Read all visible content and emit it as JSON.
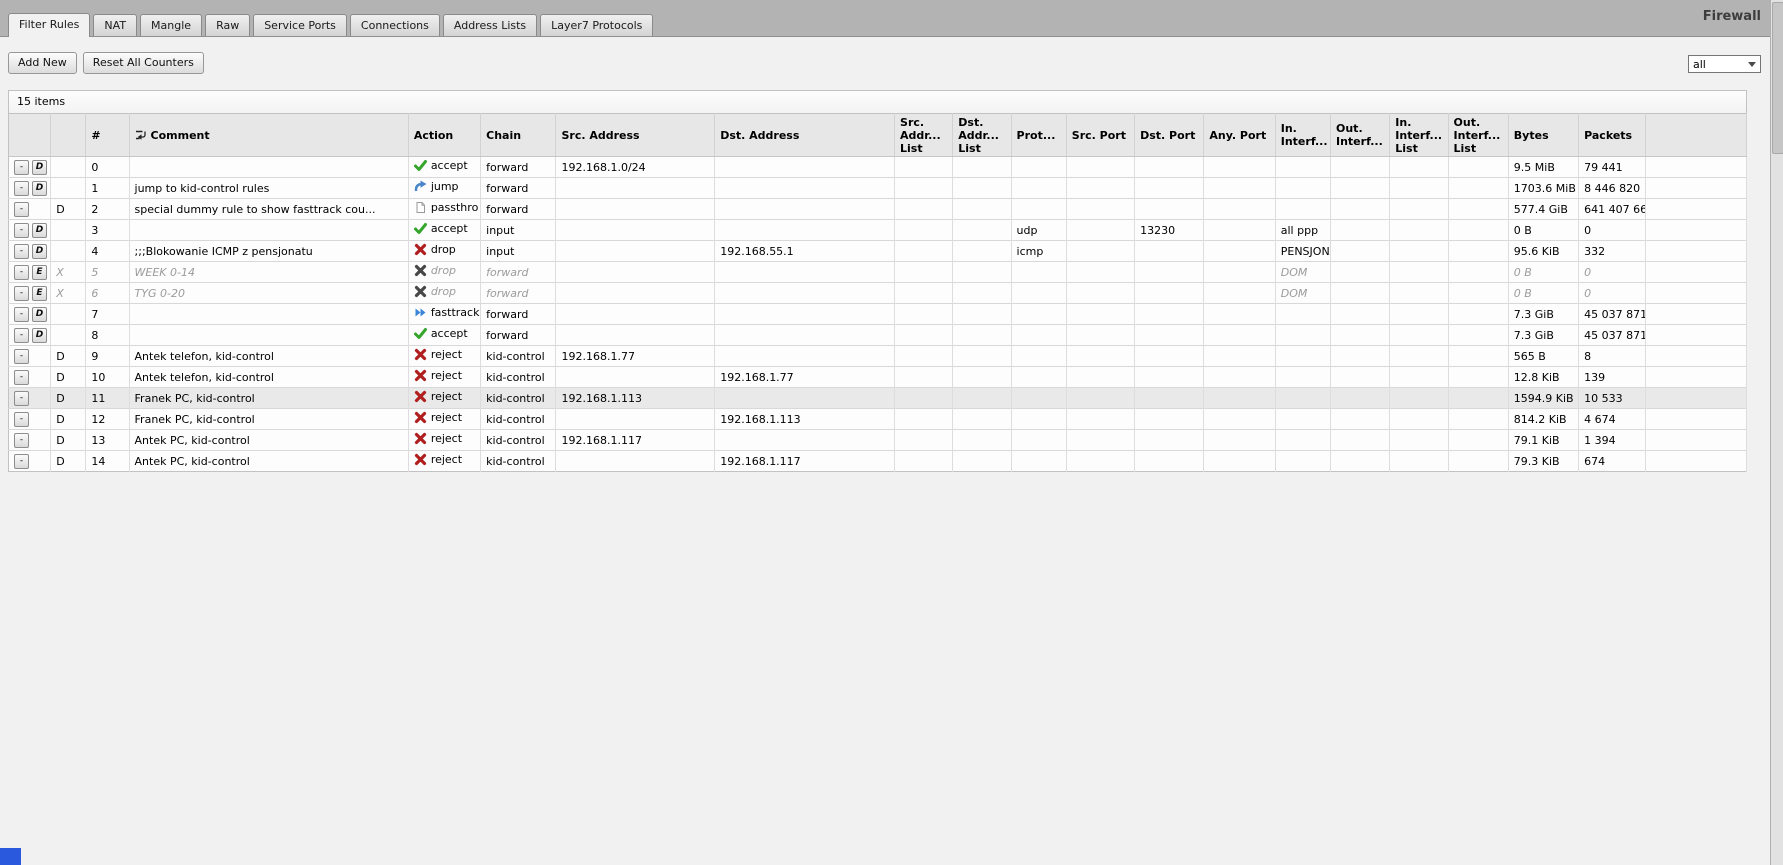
{
  "window": {
    "title": "Firewall"
  },
  "tabs": [
    {
      "label": "Filter Rules",
      "active": true
    },
    {
      "label": "NAT",
      "active": false
    },
    {
      "label": "Mangle",
      "active": false
    },
    {
      "label": "Raw",
      "active": false
    },
    {
      "label": "Service Ports",
      "active": false
    },
    {
      "label": "Connections",
      "active": false
    },
    {
      "label": "Address Lists",
      "active": false
    },
    {
      "label": "Layer7 Protocols",
      "active": false
    }
  ],
  "toolbar": {
    "add_new_label": "Add New",
    "reset_all_label": "Reset All Counters",
    "filter_dropdown_value": "all"
  },
  "table": {
    "items_label": "15 items",
    "columns": [
      {
        "key": "buttons",
        "label": ""
      },
      {
        "key": "flag",
        "label": ""
      },
      {
        "key": "num",
        "label": "#"
      },
      {
        "key": "comment",
        "label": "Comment",
        "icon": "comment-toggle-icon"
      },
      {
        "key": "action",
        "label": "Action"
      },
      {
        "key": "chain",
        "label": "Chain"
      },
      {
        "key": "src_address",
        "label": "Src. Address"
      },
      {
        "key": "dst_address",
        "label": "Dst. Address"
      },
      {
        "key": "src_addr_list",
        "label": "Src. Addr... List"
      },
      {
        "key": "dst_addr_list",
        "label": "Dst. Addr... List"
      },
      {
        "key": "protocol",
        "label": "Prot..."
      },
      {
        "key": "src_port",
        "label": "Src. Port"
      },
      {
        "key": "dst_port",
        "label": "Dst. Port"
      },
      {
        "key": "any_port",
        "label": "Any. Port"
      },
      {
        "key": "in_interface",
        "label": "In. Interf..."
      },
      {
        "key": "out_interface",
        "label": "Out. Interf..."
      },
      {
        "key": "in_interface_list",
        "label": "In. Interf... List"
      },
      {
        "key": "out_interface_list",
        "label": "Out. Interf... List"
      },
      {
        "key": "bytes",
        "label": "Bytes"
      },
      {
        "key": "packets",
        "label": "Packets"
      },
      {
        "key": "spacer",
        "label": ""
      }
    ],
    "actions": {
      "accept": {
        "label": "accept",
        "icon": "check",
        "color": "#35a52d"
      },
      "jump": {
        "label": "jump",
        "icon": "jump",
        "color": "#4a86c8"
      },
      "passthrough": {
        "label": "passthro",
        "icon": "page",
        "color": "#9a9a9a"
      },
      "drop": {
        "label": "drop",
        "icon": "cross",
        "color": "#b01f1f"
      },
      "fasttrack": {
        "label": "fasttrack",
        "icon": "fastforward",
        "color": "#3a85d8"
      },
      "reject": {
        "label": "reject",
        "icon": "cross",
        "color": "#b01f1f"
      }
    },
    "disabled_icon_color": "#474747",
    "rows": [
      {
        "buttons": [
          "-",
          "D"
        ],
        "flag": "",
        "num": "0",
        "comment": "",
        "action": "accept",
        "chain": "forward",
        "src_address": "192.168.1.0/24",
        "dst_address": "",
        "protocol": "",
        "dst_port": "",
        "in_interface": "",
        "bytes": "9.5 MiB",
        "packets": "79 441",
        "disabled": false,
        "highlight": false
      },
      {
        "buttons": [
          "-",
          "D"
        ],
        "flag": "",
        "num": "1",
        "comment": "jump to kid-control rules",
        "action": "jump",
        "chain": "forward",
        "src_address": "",
        "dst_address": "",
        "protocol": "",
        "dst_port": "",
        "in_interface": "",
        "bytes": "1703.6 MiB",
        "packets": "8 446 820",
        "disabled": false,
        "highlight": false
      },
      {
        "buttons": [
          "-"
        ],
        "flag": "D",
        "num": "2",
        "comment": "special dummy rule to show fasttrack cou...",
        "action": "passthrough",
        "chain": "forward",
        "src_address": "",
        "dst_address": "",
        "protocol": "",
        "dst_port": "",
        "in_interface": "",
        "bytes": "577.4 GiB",
        "packets": "641 407 66",
        "disabled": false,
        "highlight": false
      },
      {
        "buttons": [
          "-",
          "D"
        ],
        "flag": "",
        "num": "3",
        "comment": "",
        "action": "accept",
        "chain": "input",
        "src_address": "",
        "dst_address": "",
        "protocol": "udp",
        "dst_port": "13230",
        "in_interface": "all ppp",
        "bytes": "0 B",
        "packets": "0",
        "disabled": false,
        "highlight": false
      },
      {
        "buttons": [
          "-",
          "D"
        ],
        "flag": "",
        "num": "4",
        "comment": ";;;Blokowanie ICMP z pensjonatu",
        "action": "drop",
        "chain": "input",
        "src_address": "",
        "dst_address": "192.168.55.1",
        "protocol": "icmp",
        "dst_port": "",
        "in_interface": "PENSJONAT",
        "bytes": "95.6 KiB",
        "packets": "332",
        "disabled": false,
        "highlight": false
      },
      {
        "buttons": [
          "-",
          "E"
        ],
        "flag": "X",
        "num": "5",
        "comment": "WEEK 0-14",
        "action": "drop",
        "chain": "forward",
        "src_address": "",
        "dst_address": "",
        "protocol": "",
        "dst_port": "",
        "in_interface": "DOM",
        "bytes": "0 B",
        "packets": "0",
        "disabled": true,
        "highlight": false
      },
      {
        "buttons": [
          "-",
          "E"
        ],
        "flag": "X",
        "num": "6",
        "comment": "TYG 0-20",
        "action": "drop",
        "chain": "forward",
        "src_address": "",
        "dst_address": "",
        "protocol": "",
        "dst_port": "",
        "in_interface": "DOM",
        "bytes": "0 B",
        "packets": "0",
        "disabled": true,
        "highlight": false
      },
      {
        "buttons": [
          "-",
          "D"
        ],
        "flag": "",
        "num": "7",
        "comment": "",
        "action": "fasttrack",
        "chain": "forward",
        "src_address": "",
        "dst_address": "",
        "protocol": "",
        "dst_port": "",
        "in_interface": "",
        "bytes": "7.3 GiB",
        "packets": "45 037 871",
        "disabled": false,
        "highlight": false
      },
      {
        "buttons": [
          "-",
          "D"
        ],
        "flag": "",
        "num": "8",
        "comment": "",
        "action": "accept",
        "chain": "forward",
        "src_address": "",
        "dst_address": "",
        "protocol": "",
        "dst_port": "",
        "in_interface": "",
        "bytes": "7.3 GiB",
        "packets": "45 037 871",
        "disabled": false,
        "highlight": false
      },
      {
        "buttons": [
          "-"
        ],
        "flag": "D",
        "num": "9",
        "comment": "Antek telefon, kid-control",
        "action": "reject",
        "chain": "kid-control",
        "src_address": "192.168.1.77",
        "dst_address": "",
        "protocol": "",
        "dst_port": "",
        "in_interface": "",
        "bytes": "565 B",
        "packets": "8",
        "disabled": false,
        "highlight": false
      },
      {
        "buttons": [
          "-"
        ],
        "flag": "D",
        "num": "10",
        "comment": "Antek telefon, kid-control",
        "action": "reject",
        "chain": "kid-control",
        "src_address": "",
        "dst_address": "192.168.1.77",
        "protocol": "",
        "dst_port": "",
        "in_interface": "",
        "bytes": "12.8 KiB",
        "packets": "139",
        "disabled": false,
        "highlight": false
      },
      {
        "buttons": [
          "-"
        ],
        "flag": "D",
        "num": "11",
        "comment": "Franek PC, kid-control",
        "action": "reject",
        "chain": "kid-control",
        "src_address": "192.168.1.113",
        "dst_address": "",
        "protocol": "",
        "dst_port": "",
        "in_interface": "",
        "bytes": "1594.9 KiB",
        "packets": "10 533",
        "disabled": false,
        "highlight": true
      },
      {
        "buttons": [
          "-"
        ],
        "flag": "D",
        "num": "12",
        "comment": "Franek PC, kid-control",
        "action": "reject",
        "chain": "kid-control",
        "src_address": "",
        "dst_address": "192.168.1.113",
        "protocol": "",
        "dst_port": "",
        "in_interface": "",
        "bytes": "814.2 KiB",
        "packets": "4 674",
        "disabled": false,
        "highlight": false
      },
      {
        "buttons": [
          "-"
        ],
        "flag": "D",
        "num": "13",
        "comment": "Antek PC, kid-control",
        "action": "reject",
        "chain": "kid-control",
        "src_address": "192.168.1.117",
        "dst_address": "",
        "protocol": "",
        "dst_port": "",
        "in_interface": "",
        "bytes": "79.1 KiB",
        "packets": "1 394",
        "disabled": false,
        "highlight": false
      },
      {
        "buttons": [
          "-"
        ],
        "flag": "D",
        "num": "14",
        "comment": "Antek PC, kid-control",
        "action": "reject",
        "chain": "kid-control",
        "src_address": "",
        "dst_address": "192.168.1.117",
        "protocol": "",
        "dst_port": "",
        "in_interface": "",
        "bytes": "79.3 KiB",
        "packets": "674",
        "disabled": false,
        "highlight": false
      }
    ]
  }
}
